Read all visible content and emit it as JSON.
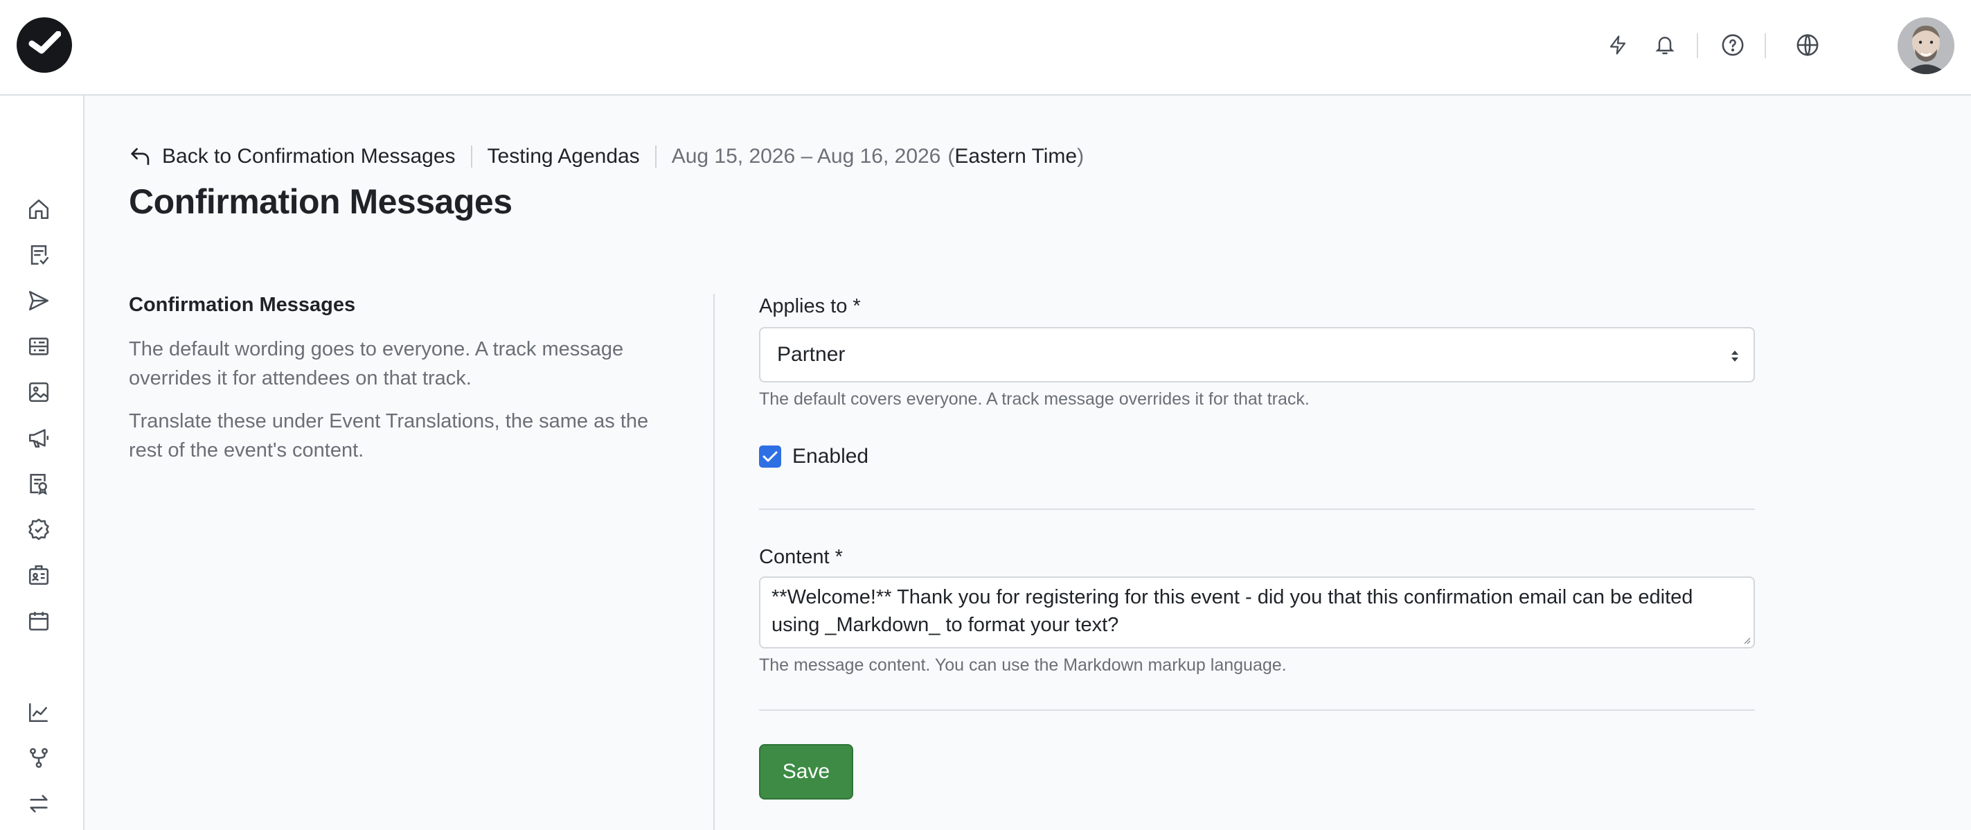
{
  "breadcrumb": {
    "back_label": "Back to Confirmation Messages",
    "event_name": "Testing Agendas",
    "date_range": "Aug 15, 2026 – Aug 16, 2026",
    "timezone_open": "(",
    "timezone": "Eastern Time",
    "timezone_close": ")"
  },
  "page": {
    "title": "Confirmation Messages"
  },
  "info": {
    "heading": "Confirmation Messages",
    "paragraphs": [
      "The default wording goes to everyone. A track message overrides it for attendees on that track.",
      "Translate these under Event Translations, the same as the rest of the event's content."
    ]
  },
  "form": {
    "applies_to": {
      "label": "Applies to *",
      "value": "Partner",
      "help": "The default covers everyone. A track message overrides it for that track."
    },
    "enabled": {
      "label": "Enabled",
      "checked": true
    },
    "content": {
      "label": "Content *",
      "value": "**Welcome!** Thank you for registering for this event - did you that this confirmation email can be edited using _Markdown_ to format your text?",
      "help": "The message content. You can use the Markdown markup language."
    },
    "save_label": "Save"
  },
  "icons": {
    "topbar": [
      "lightning-icon",
      "bell-icon",
      "help-circle-icon",
      "globe-icon"
    ],
    "sidebar": [
      "home-icon",
      "checklist-icon",
      "send-icon",
      "list-icon",
      "image-icon",
      "megaphone-icon",
      "badge-search-icon",
      "check-badge-icon",
      "id-card-icon",
      "calendar-icon",
      "chart-line-icon",
      "branch-icon",
      "swap-icon"
    ]
  },
  "colors": {
    "accent": "#2f6fe4",
    "save": "#3d8b45",
    "logo": "#15171a"
  }
}
